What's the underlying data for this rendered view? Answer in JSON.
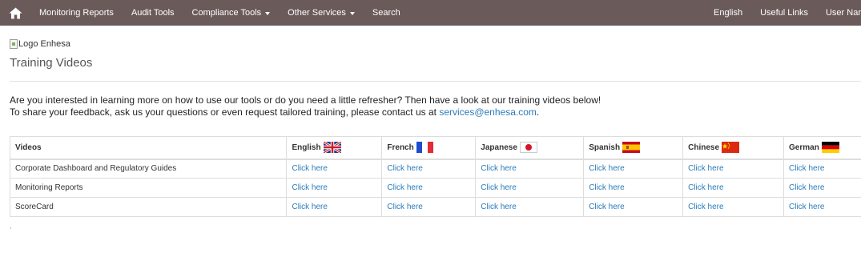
{
  "nav": {
    "items": [
      "Monitoring Reports",
      "Audit Tools",
      "Compliance Tools",
      "Other Services",
      "Search"
    ],
    "right_items": [
      "English",
      "Useful Links",
      "User Nar"
    ],
    "home_icon": "home-icon",
    "bg_color": "#6b5a5a"
  },
  "header": {
    "logo_alt": "Logo Enhesa",
    "title": "Training Videos"
  },
  "intro": {
    "line1": "Are you interested in learning more on how to use our tools or do you need a little refresher? Then have a look at our training videos below!",
    "line2_prefix": "To share your feedback, ask us your questions or even request tailored training, please contact us at ",
    "email": "services@enhesa.com",
    "line2_suffix": "."
  },
  "table": {
    "headers": [
      "Videos",
      "English",
      "French",
      "Japanese",
      "Spanish",
      "Chinese",
      "German"
    ],
    "rows": [
      {
        "name": "Corporate Dashboard and Regulatory Guides",
        "links": [
          "Click here",
          "Click here",
          "Click here",
          "Click here",
          "Click here",
          "Click here"
        ]
      },
      {
        "name": "Monitoring Reports",
        "links": [
          "Click here",
          "Click here",
          "Click here",
          "Click here",
          "Click here",
          "Click here"
        ]
      },
      {
        "name": "ScoreCard",
        "links": [
          "Click here",
          "Click here",
          "Click here",
          "Click here",
          "Click here",
          "Click here"
        ]
      }
    ]
  },
  "footer_mark": ",",
  "colors": {
    "link": "#2b7bb9",
    "border": "#dddddd"
  }
}
